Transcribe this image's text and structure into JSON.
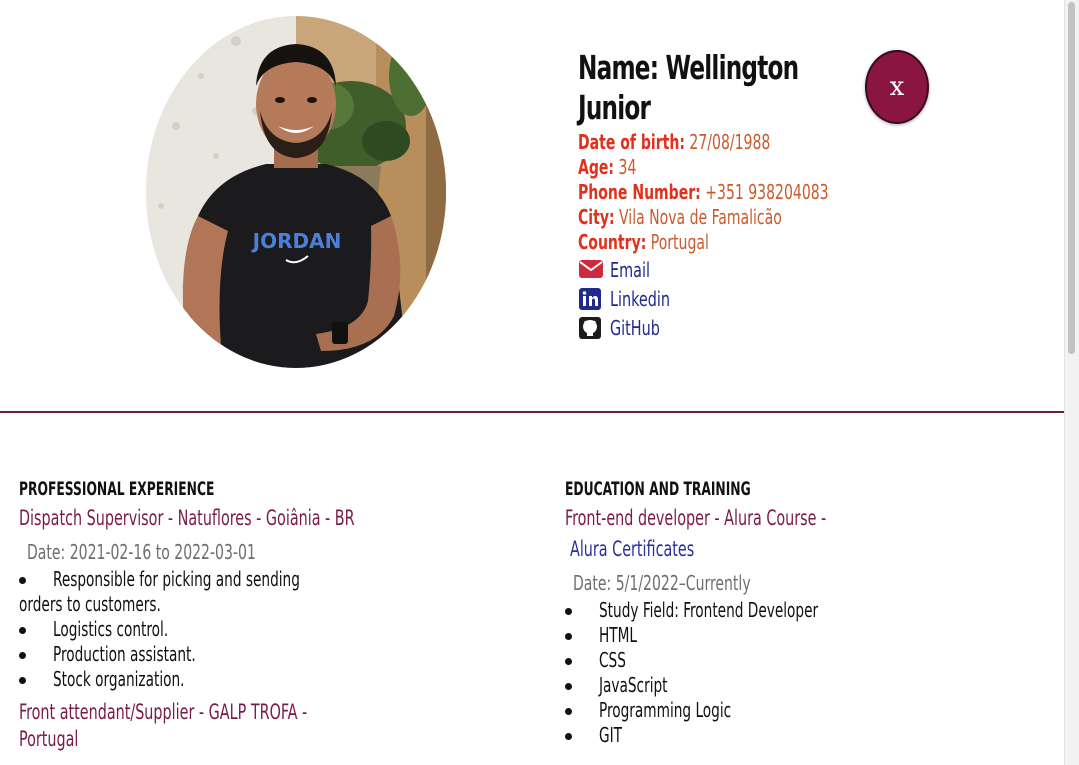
{
  "profile": {
    "name": "Name: Wellington Junior",
    "birth_label": "Date of birth:",
    "birth_value": "27/08/1988",
    "age_label": "Age:",
    "age_value": "34",
    "phone_label": "Phone Number:",
    "phone_value": "+351 938204083",
    "city_label": "City:",
    "city_value": "Vila Nova de Famalicão",
    "country_label": "Country:",
    "country_value": "Portugal",
    "photo_shirt_text": "JORDAN"
  },
  "links": {
    "email": "Email",
    "linkedin": "Linkedin",
    "github": "GitHub"
  },
  "close_label": "x",
  "experience": {
    "title": "PROFESSIONAL EXPERIENCE",
    "jobs": [
      {
        "role": "Dispatch Supervisor - Natuflores - Goiânia - BR",
        "date": "Date: 2021-02-16 to 2022-03-01",
        "tasks_line1": "Responsible for picking and sending",
        "tasks_line1_cont": "orders to customers.",
        "tasks": [
          "Logistics control.",
          "Production assistant.",
          "Stock organization."
        ]
      },
      {
        "role_line1": "Front attendant/Supplier - GALP TROFA -",
        "role_line2": "Portugal"
      }
    ]
  },
  "education": {
    "title": "EDUCATION AND TRAINING",
    "course_line1": "Front-end developer - Alura Course -",
    "course_line2": "Alura Certificates",
    "date": "Date: 5/1/2022–Currently",
    "items": [
      "Study Field: Frontend Developer",
      "HTML",
      "CSS",
      "JavaScript",
      "Programming Logic",
      "GIT"
    ]
  },
  "colors": {
    "accent": "#8a1540",
    "divider": "#6b1d3a",
    "label": "#e0311e",
    "value": "#cc5a2e",
    "link": "#1f2a8c"
  },
  "icons": [
    "envelope-icon",
    "linkedin-icon",
    "github-icon"
  ]
}
